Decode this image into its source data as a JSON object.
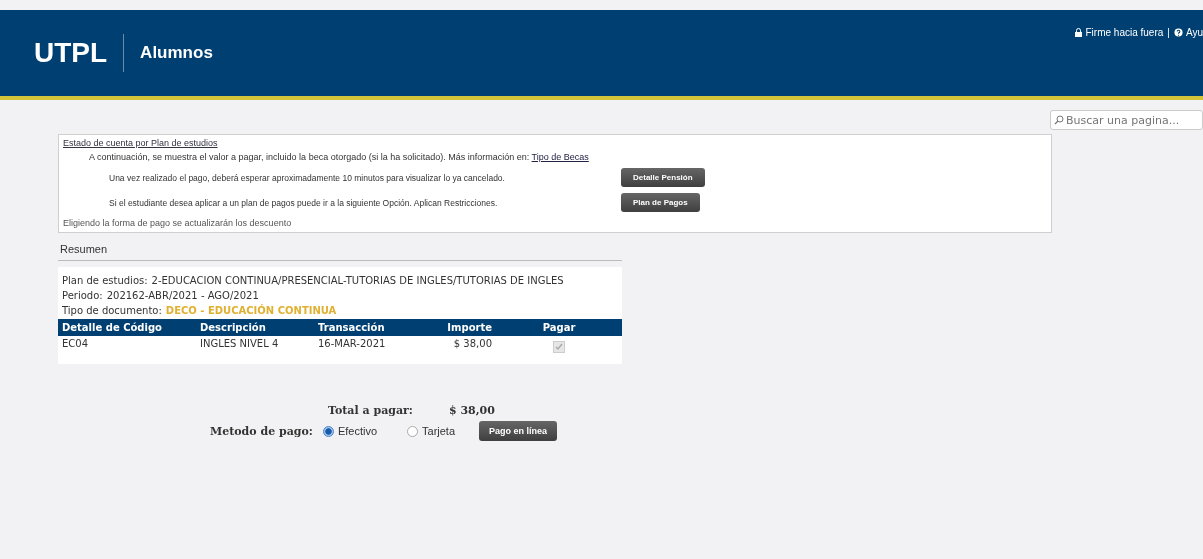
{
  "header": {
    "logo": "UTPL",
    "section": "Alumnos",
    "signout": "Firme hacia fuera",
    "separator": "|",
    "help": "Ayu"
  },
  "search": {
    "placeholder": "Buscar una pagina..."
  },
  "statement": {
    "title": "Estado de cuenta por Plan de estudios",
    "intro": "A continuación, se muestra el valor a pagar, incluido la beca otorgado (si la ha solicitado). Más información en:",
    "intro_link": "Tipo de Becas",
    "notes": [
      {
        "text": "Una vez realizado el pago, deberá esperar aproximadamente 10 minutos para visualizar lo ya cancelado.",
        "button": "Detalle Pensión"
      },
      {
        "text": "Si el estudiante desea aplicar a un plan de pagos puede ir a la siguiente Opción. Aplican Restricciones.",
        "button": "Plan de Pagos"
      }
    ],
    "footer": "Eligiendo la forma de pago se actualizarán los descuento"
  },
  "summary": {
    "title": "Resumen",
    "plan_label": "Plan de estudios:",
    "plan": "2-EDUCACION CONTINUA/PRESENCIAL-TUTORIAS DE INGLES/TUTORIAS DE INGLES",
    "period_label": "Periodo:",
    "period": "202162-ABR/2021 - AGO/2021",
    "doc_label": "Tipo de documento:",
    "doc": "DECO - EDUCACIÓN CONTINUA",
    "table": {
      "columns": [
        "Detalle de Código",
        "Descripción",
        "Transacción",
        "Importe",
        "Pagar"
      ],
      "rows": [
        {
          "code": "EC04",
          "description": "INGLES NIVEL 4",
          "date": "16-MAR-2021",
          "amount": "$ 38,00",
          "checked": true,
          "disabled": true
        }
      ]
    }
  },
  "total": {
    "label": "Total a pagar:",
    "value": "$ 38,00"
  },
  "payment": {
    "label": "Metodo de pago:",
    "options": [
      {
        "label": "Efectivo",
        "selected": true
      },
      {
        "label": "Tarjeta",
        "selected": false
      }
    ],
    "button": "Pago en línea"
  }
}
